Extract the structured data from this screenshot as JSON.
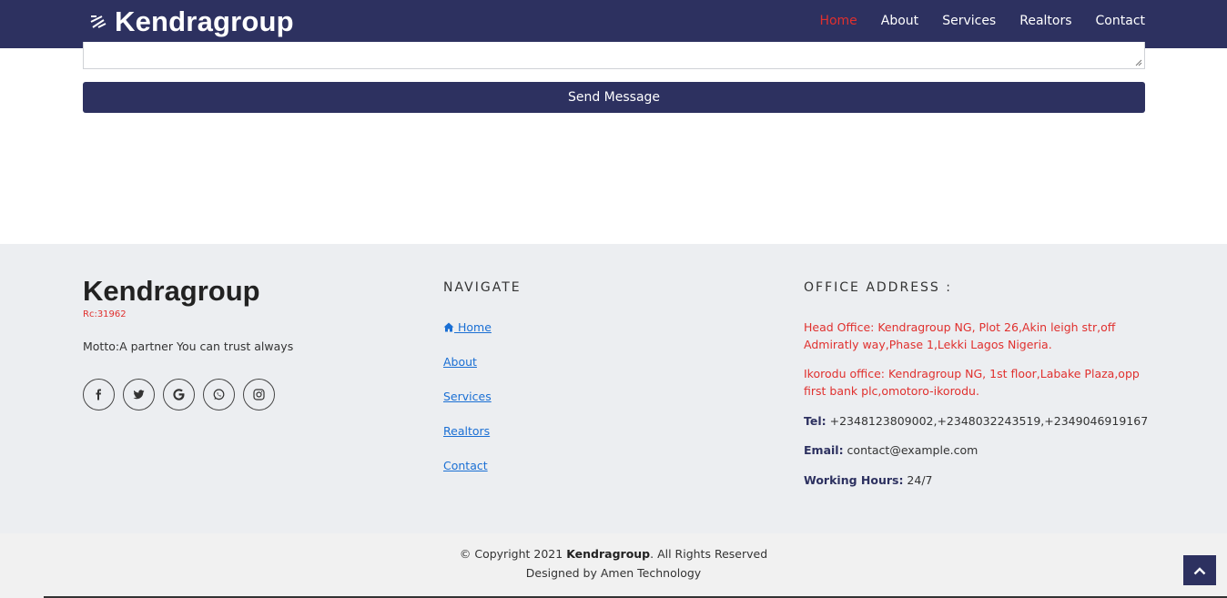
{
  "header": {
    "brand": "Kendragroup",
    "nav": [
      {
        "label": "Home",
        "active": true
      },
      {
        "label": "About",
        "active": false
      },
      {
        "label": "Services",
        "active": false
      },
      {
        "label": "Realtors",
        "active": false
      },
      {
        "label": "Contact",
        "active": false
      }
    ]
  },
  "form": {
    "send_label": "Send Message"
  },
  "footer": {
    "brand": "Kendragroup",
    "rc": "Rc:31962",
    "motto": "Motto:A partner You can trust always",
    "socials": [
      "facebook-icon",
      "twitter-icon",
      "google-icon",
      "whatsapp-icon",
      "instagram-icon"
    ],
    "navigate_heading": "NAVIGATE",
    "links": [
      " Home",
      " About",
      " Services",
      "Realtors",
      "Contact"
    ],
    "office_heading": "OFFICE ADDRESS :",
    "head_office": "Head Office: Kendragroup NG, Plot 26,Akin leigh str,off Admiratly way,Phase 1,Lekki Lagos Nigeria.",
    "ikorodu_office": "Ikorodu office: Kendragroup NG, 1st floor,Labake Plaza,opp first bank plc,omotoro-ikorodu.",
    "tel_label": "Tel:",
    "tel_value": " +2348123809002,+2348032243519,+2349046919167",
    "email_label": "Email:",
    "email_value": " contact@example.com",
    "hours_label": "Working Hours:",
    "hours_value": " 24/7"
  },
  "bottom": {
    "copyright_prefix": "© Copyright 2021 ",
    "copyright_brand": "Kendragroup",
    "copyright_suffix": ". All Rights Reserved",
    "designed_by": "Designed by Amen Technology"
  },
  "colors": {
    "primary": "#2d3160",
    "accent": "#e0302e",
    "link": "#1a6fd4",
    "footer_bg": "#eceef1"
  }
}
